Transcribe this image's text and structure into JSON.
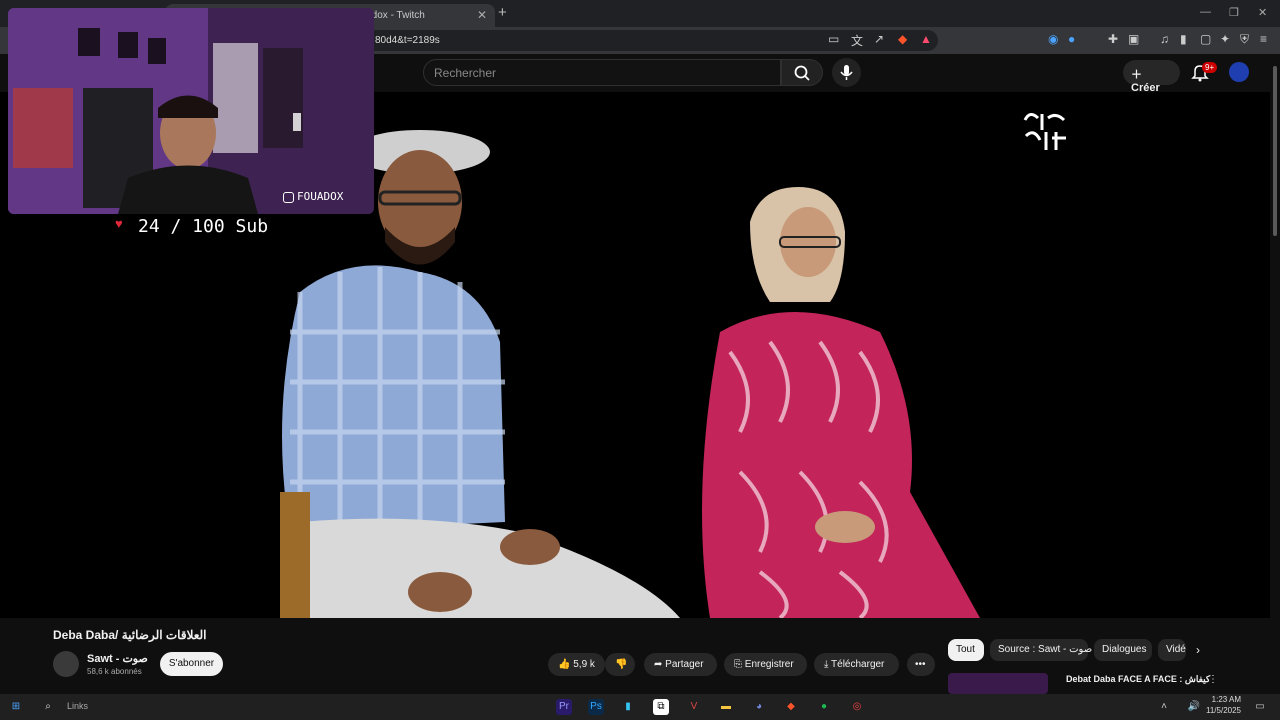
{
  "browser": {
    "tabs": [
      {
        "label": ""
      },
      {
        "label": "ouadox - Twitch"
      }
    ],
    "url": "80d4&t=2189s"
  },
  "youtube": {
    "search_placeholder": "Rechercher",
    "create_label": "Créer",
    "notif_count": "9+"
  },
  "overlay": {
    "instagram_handle": "FOUADOX",
    "sub_goal": "24 / 100 Sub"
  },
  "video": {
    "title": "Deba Daba/ العلاقات الرضائية",
    "channel_name": "Sawt - صوت",
    "subscribers": "58,6 k abonnés",
    "subscribe_label": "S'abonner",
    "likes": "5,9 k",
    "share_label": "Partager",
    "save_label": "Enregistrer",
    "download_label": "Télécharger"
  },
  "chips": [
    {
      "label": "Tout"
    },
    {
      "label": "Source : Sawt - صوت"
    },
    {
      "label": "Dialogues"
    },
    {
      "label": "Vidé"
    }
  ],
  "related": {
    "title": "Debat Daba FACE A FACE : كيفاش"
  },
  "taskbar": {
    "search_label": "Links",
    "time": "1:23 AM",
    "date": "11/5/2025"
  },
  "colors": {
    "accent_red": "#cc0000",
    "heart": "#e0283a"
  }
}
